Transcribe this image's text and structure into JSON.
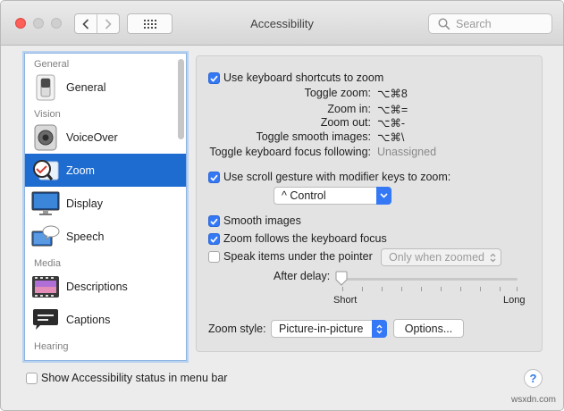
{
  "window": {
    "title": "Accessibility"
  },
  "toolbar": {
    "search_placeholder": "Search"
  },
  "sidebar": {
    "items": [
      {
        "type": "section",
        "label": "General"
      },
      {
        "type": "item",
        "label": "General",
        "icon": "switch-icon"
      },
      {
        "type": "section",
        "label": "Vision"
      },
      {
        "type": "item",
        "label": "VoiceOver",
        "icon": "speaker-icon"
      },
      {
        "type": "item",
        "label": "Zoom",
        "icon": "magnifier-icon",
        "selected": true
      },
      {
        "type": "item",
        "label": "Display",
        "icon": "monitor-icon"
      },
      {
        "type": "item",
        "label": "Speech",
        "icon": "speech-bubble-icon"
      },
      {
        "type": "section",
        "label": "Media"
      },
      {
        "type": "item",
        "label": "Descriptions",
        "icon": "film-icon"
      },
      {
        "type": "item",
        "label": "Captions",
        "icon": "caption-bubble-icon"
      },
      {
        "type": "section",
        "label": "Hearing"
      }
    ]
  },
  "zoom": {
    "shortcuts_label": "Use keyboard shortcuts to zoom",
    "shortcuts_checked": true,
    "shortcuts": [
      {
        "label": "Toggle zoom:",
        "key": "⌥⌘8"
      },
      {
        "label": "Zoom in:",
        "key": "⌥⌘="
      },
      {
        "label": "Zoom out:",
        "key": "⌥⌘-"
      },
      {
        "label": "Toggle smooth images:",
        "key": "⌥⌘\\"
      },
      {
        "label": "Toggle keyboard focus following:",
        "key": "Unassigned"
      }
    ],
    "scroll_label": "Use scroll gesture with modifier keys to zoom:",
    "scroll_checked": true,
    "modifier_value": "^ Control",
    "smooth_label": "Smooth images",
    "smooth_checked": true,
    "focus_label": "Zoom follows the keyboard focus",
    "focus_checked": true,
    "speak_label": "Speak items under the pointer",
    "speak_checked": false,
    "speak_mode_value": "Only when zoomed",
    "delay_label": "After delay:",
    "delay_min": "Short",
    "delay_max": "Long",
    "delay_value": 0,
    "style_label": "Zoom style:",
    "style_value": "Picture-in-picture",
    "options_label": "Options..."
  },
  "footer": {
    "status_label": "Show Accessibility status in menu bar",
    "status_checked": false,
    "help_label": "?"
  },
  "watermark": "wsxdn.com",
  "colors": {
    "accent": "#3478f6",
    "selection": "#1f6cd0",
    "close": "#fc5f57"
  }
}
